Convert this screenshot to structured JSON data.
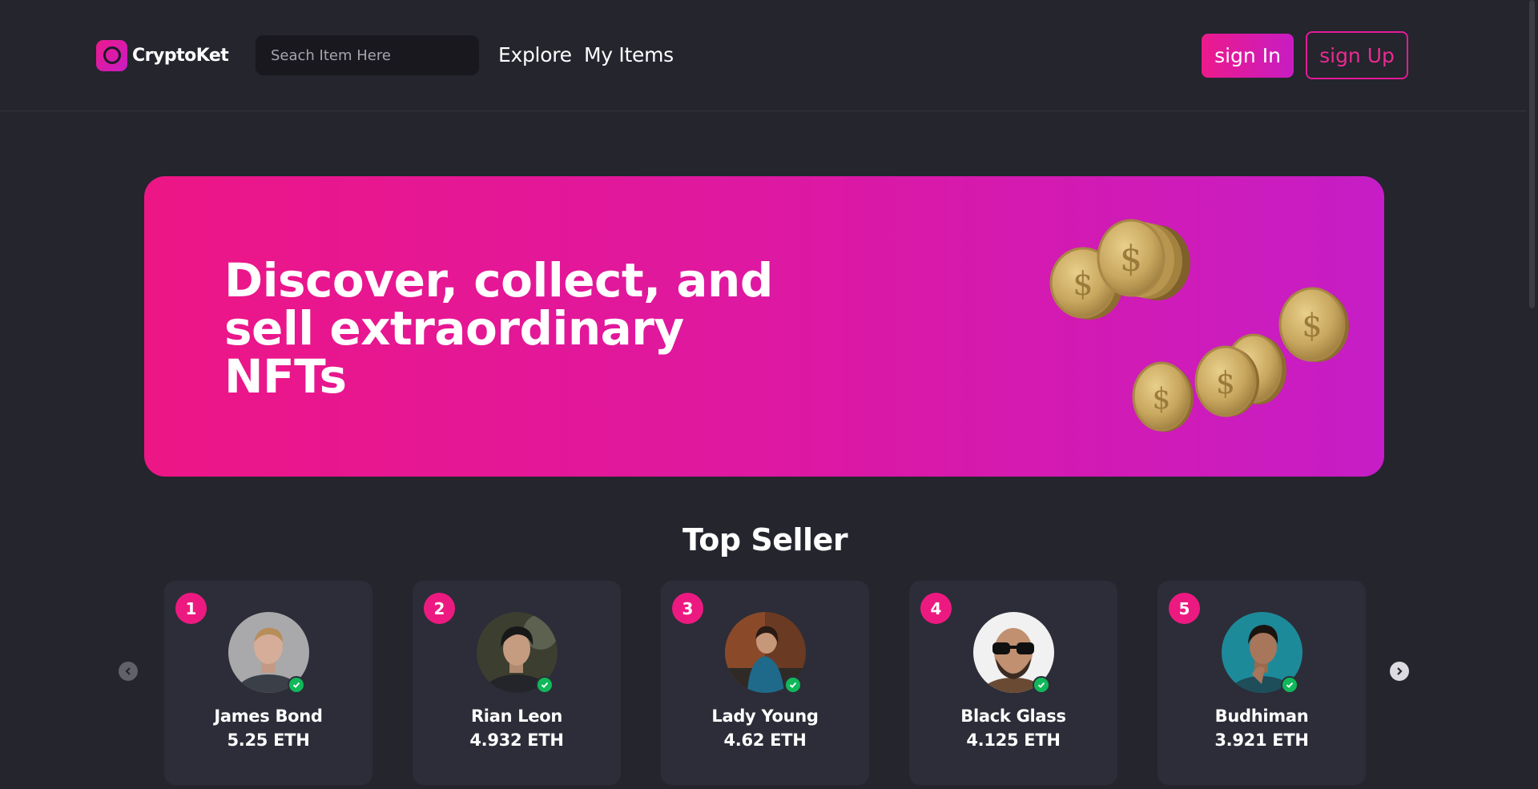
{
  "brand": {
    "name": "CryptoKet",
    "logo_icon": "ring-logo-icon"
  },
  "search": {
    "placeholder": "Seach Item Here"
  },
  "nav": {
    "explore": "Explore",
    "my_items": "My Items"
  },
  "auth": {
    "sign_in": "sign In",
    "sign_up": "sign Up"
  },
  "colors": {
    "accent": "#ec1a8c",
    "accent_end": "#c71cc2",
    "background": "#24252d",
    "card": "#2c2d38",
    "verified": "#10b85a"
  },
  "hero": {
    "title_lines": [
      "Discover, collect, and",
      "sell extraordinary",
      "NFTs"
    ]
  },
  "top_seller": {
    "title": "Top Seller",
    "prev_icon": "chevron-left-icon",
    "next_icon": "chevron-right-icon",
    "sellers": [
      {
        "rank": "1",
        "name": "James Bond",
        "eth": "5.25 ETH"
      },
      {
        "rank": "2",
        "name": "Rian Leon",
        "eth": "4.932 ETH"
      },
      {
        "rank": "3",
        "name": "Lady Young",
        "eth": "4.62 ETH"
      },
      {
        "rank": "4",
        "name": "Black Glass",
        "eth": "4.125 ETH"
      },
      {
        "rank": "5",
        "name": "Budhiman",
        "eth": "3.921 ETH"
      }
    ]
  }
}
